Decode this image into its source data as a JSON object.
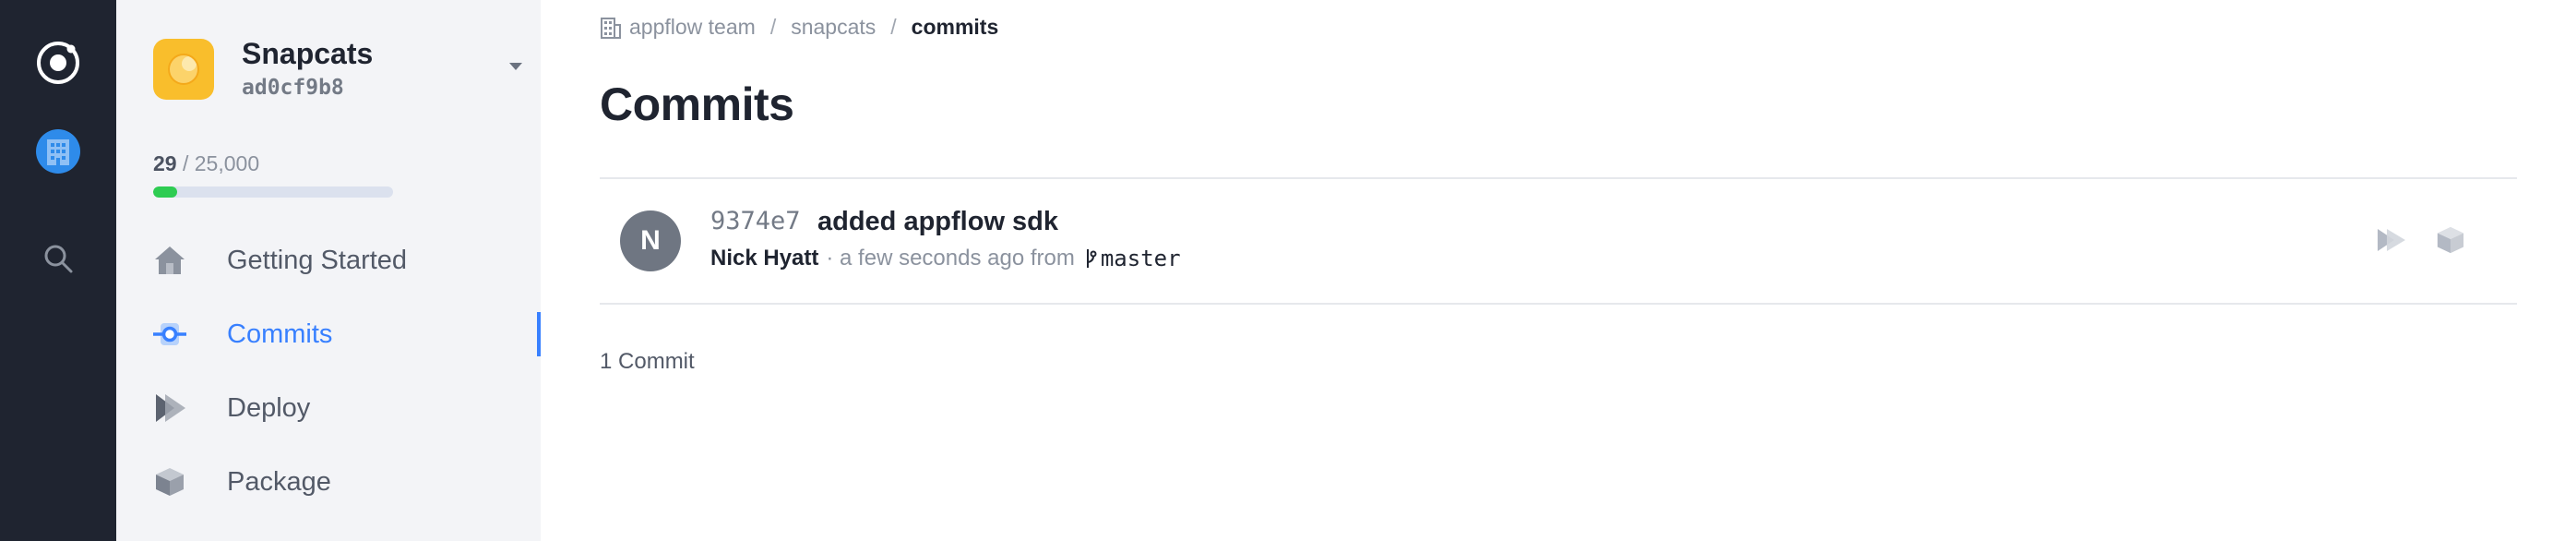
{
  "rail": {
    "icons": [
      "ionic-logo-icon",
      "organization-icon",
      "search-icon"
    ],
    "org_color": "#2e8bea"
  },
  "app": {
    "name": "Snapcats",
    "id": "ad0cf9b8",
    "icon_color": "#f9be2c"
  },
  "usage": {
    "used": "29",
    "separator": " / ",
    "limit": "25,000",
    "fill_fraction": 0.1,
    "fill_color": "#2ecc52"
  },
  "nav": {
    "items": [
      {
        "label": "Getting Started",
        "icon": "home-icon",
        "active": false
      },
      {
        "label": "Commits",
        "icon": "commit-icon",
        "active": true
      },
      {
        "label": "Deploy",
        "icon": "deploy-icon",
        "active": false
      },
      {
        "label": "Package",
        "icon": "package-icon",
        "active": false
      }
    ],
    "active_color": "#3880ff"
  },
  "breadcrumb": {
    "team": "appflow team",
    "app": "snapcats",
    "current": "commits",
    "separator": "/"
  },
  "page_title": "Commits",
  "commits": [
    {
      "avatar_initial": "N",
      "sha": "9374e7",
      "message": "added appflow sdk",
      "author": "Nick Hyatt",
      "time_text": "· a few seconds ago from",
      "branch": "master"
    }
  ],
  "commit_count": "1 Commit"
}
